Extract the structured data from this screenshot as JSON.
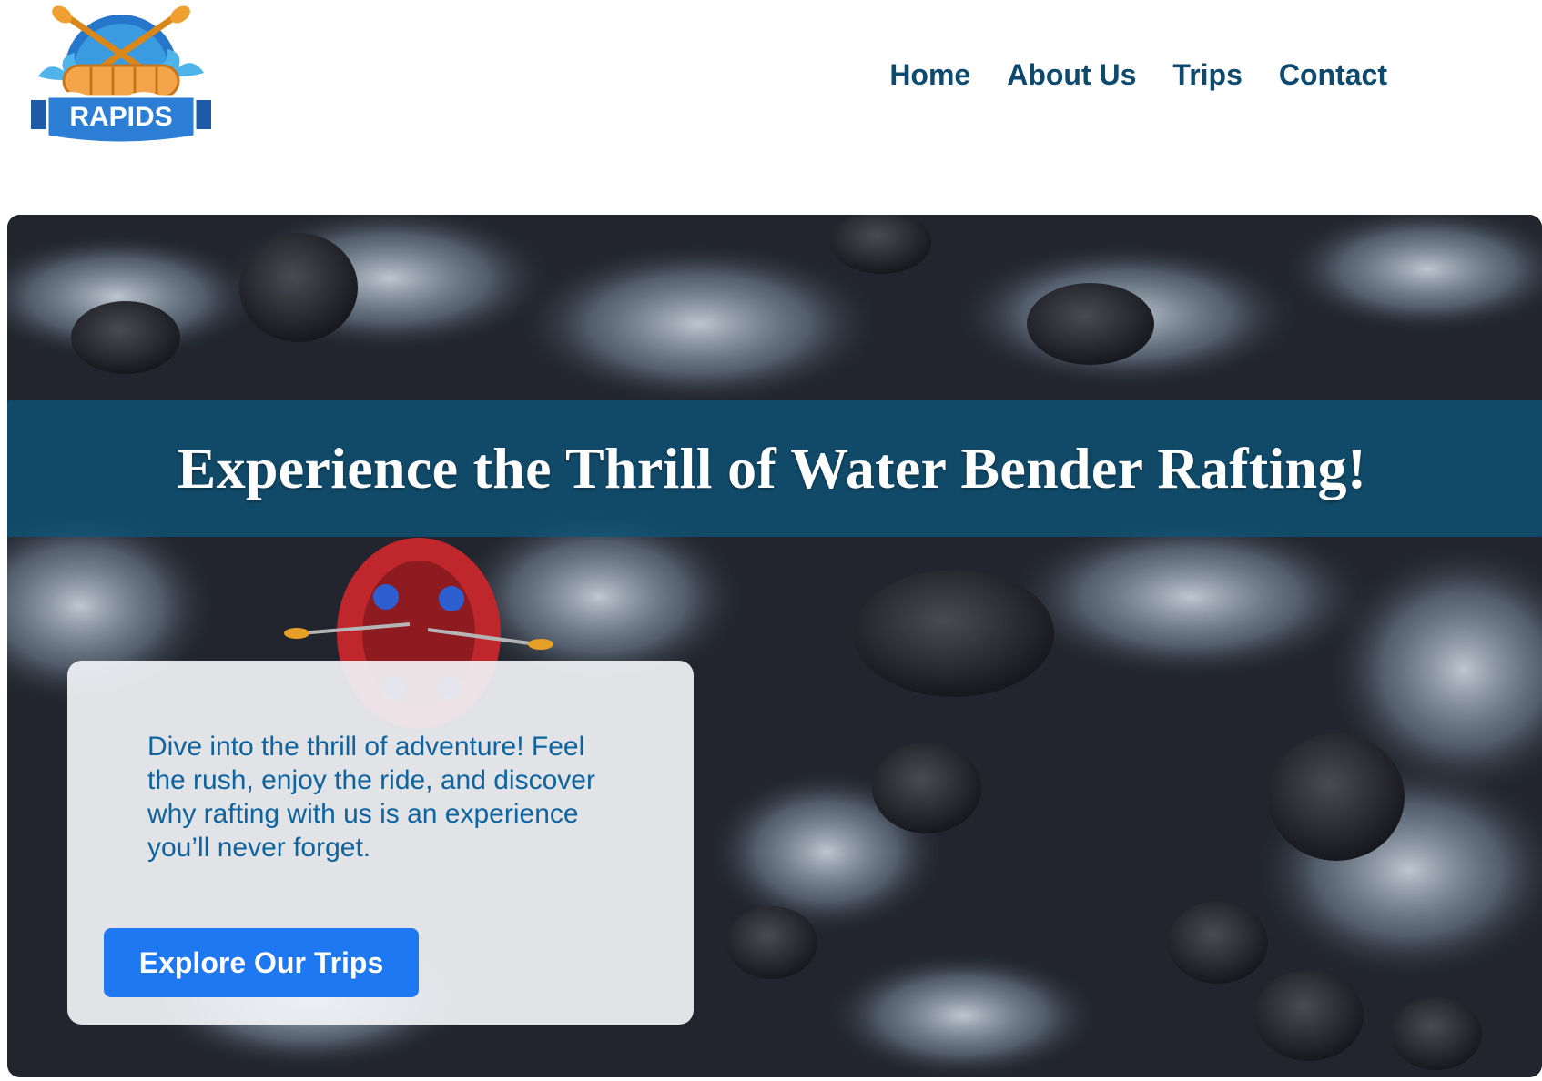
{
  "header": {
    "logo_text": "RAPIDS",
    "nav": [
      "Home",
      "About Us",
      "Trips",
      "Contact"
    ]
  },
  "hero": {
    "title": "Experience the Thrill of Water Bender Rafting!",
    "description": "Dive into the thrill of adventure! Feel the rush, enjoy the ride, and discover why rafting with us is an experience you’ll never forget.",
    "cta_label": "Explore Our Trips"
  },
  "colors": {
    "nav_text": "#0e4a6e",
    "banner": "#0d547a",
    "card_text": "#0f64a0",
    "cta": "#1d78f2"
  }
}
